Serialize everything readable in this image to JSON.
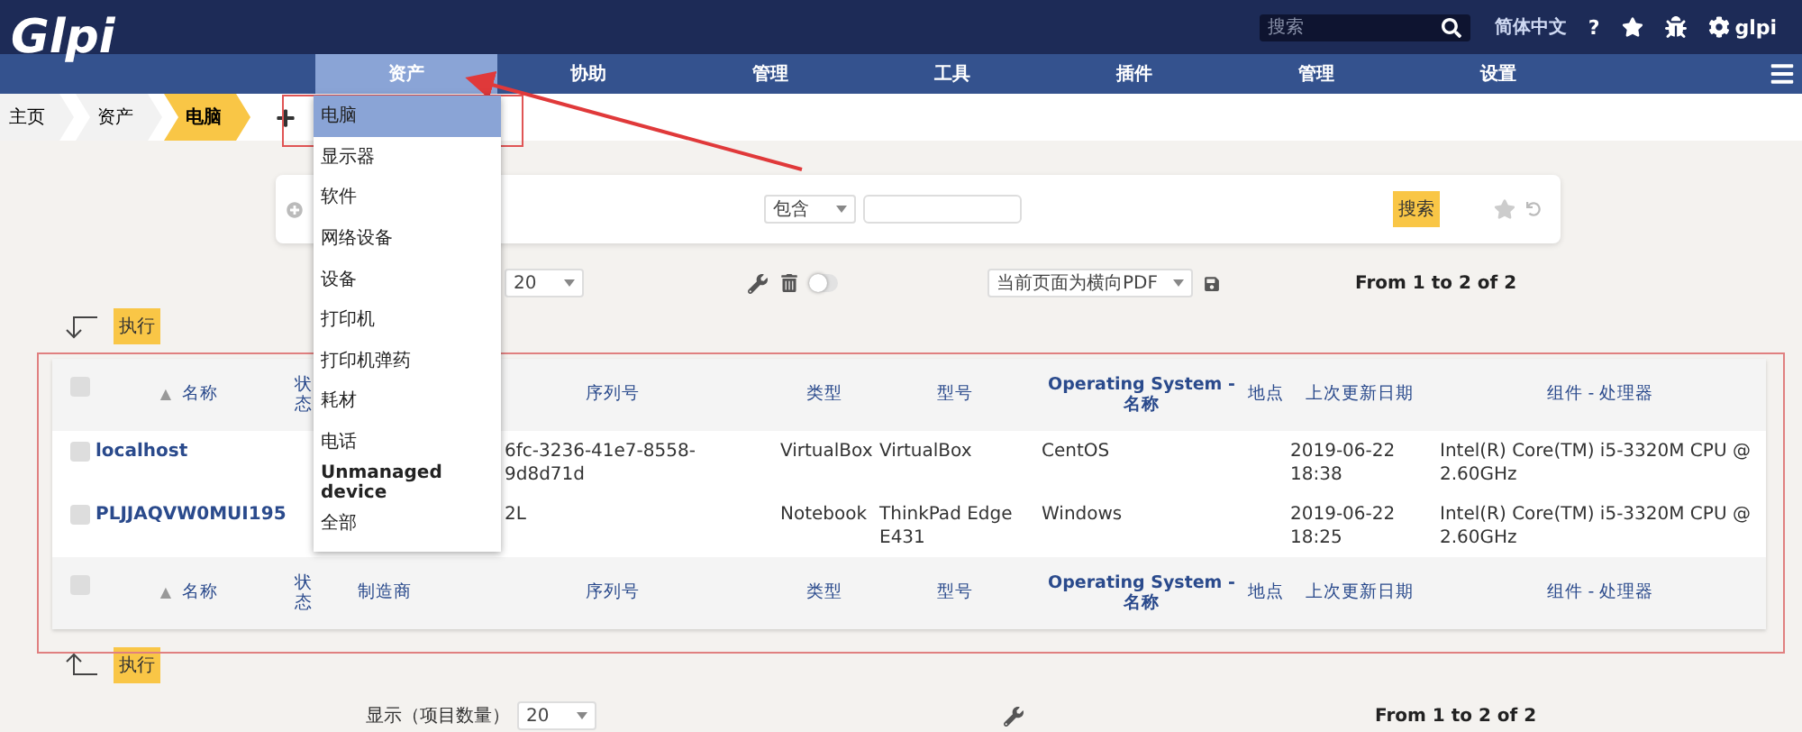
{
  "header": {
    "logo": "Glpi",
    "search_placeholder": "搜索",
    "language": "简体中文",
    "help": "?",
    "user": "glpi"
  },
  "nav": [
    {
      "label": "资产",
      "selected": true
    },
    {
      "label": "协助",
      "selected": false
    },
    {
      "label": "管理",
      "selected": false
    },
    {
      "label": "工具",
      "selected": false
    },
    {
      "label": "插件",
      "selected": false
    },
    {
      "label": "管理",
      "selected": false
    },
    {
      "label": "设置",
      "selected": false
    }
  ],
  "breadcrumb": [
    {
      "label": "主页",
      "selected": false
    },
    {
      "label": "资产",
      "selected": false
    },
    {
      "label": "电脑",
      "selected": true
    }
  ],
  "assets_menu": [
    {
      "label": "电脑",
      "selected": true,
      "bold": false
    },
    {
      "label": "显示器",
      "selected": false,
      "bold": false
    },
    {
      "label": "软件",
      "selected": false,
      "bold": false
    },
    {
      "label": "网络设备",
      "selected": false,
      "bold": false
    },
    {
      "label": "设备",
      "selected": false,
      "bold": false
    },
    {
      "label": "打印机",
      "selected": false,
      "bold": false
    },
    {
      "label": "打印机弹药",
      "selected": false,
      "bold": false
    },
    {
      "label": "耗材",
      "selected": false,
      "bold": false
    },
    {
      "label": "电话",
      "selected": false,
      "bold": false
    },
    {
      "label": "Unmanaged device",
      "selected": false,
      "bold": true
    },
    {
      "label": "全部",
      "selected": false,
      "bold": false
    }
  ],
  "search_panel": {
    "operator": "包含",
    "button": "搜索"
  },
  "list_controls": {
    "per_page": "20",
    "toggle_on": false,
    "export": "当前页面为横向PDF",
    "pagination": "From 1 to 2 of 2",
    "action": "执行"
  },
  "table": {
    "select_all": [
      {
        "checked": false
      },
      {
        "checked": false
      }
    ],
    "header_top": [
      {
        "kind": "label",
        "label": "名称",
        "sort_mark": "▲"
      },
      {
        "kind": "label",
        "label": "状态"
      },
      {
        "kind": "covered"
      },
      {
        "kind": "label",
        "label": "序列号"
      },
      {
        "kind": "label",
        "label": "类型"
      },
      {
        "kind": "label",
        "label": "型号"
      },
      {
        "kind": "label",
        "label": "Operating System - 名称"
      },
      {
        "kind": "label",
        "label": "地点"
      },
      {
        "kind": "label",
        "label": "上次更新日期"
      },
      {
        "kind": "label",
        "label": "组件 - 处理器"
      }
    ],
    "rows": [
      {
        "checked": false,
        "cells": [
          "localhost",
          null,
          null,
          "6fc-3236-41e7-8558-9d8d71d",
          "VirtualBox",
          "VirtualBox",
          "CentOS",
          null,
          "2019-06-22 18:38",
          "Intel(R) Core(TM) i5-3320M CPU @ 2.60GHz"
        ]
      },
      {
        "checked": false,
        "cells": [
          "PLJJAQVW0MUI195",
          null,
          null,
          "2L",
          "Notebook",
          "ThinkPad Edge E431",
          "Windows",
          null,
          "2019-06-22 18:25",
          "Intel(R) Core(TM) i5-3320M CPU @ 2.60GHz"
        ]
      }
    ],
    "header_bottom": [
      {
        "kind": "label",
        "label": "名称",
        "sort_mark": "▲"
      },
      {
        "kind": "label",
        "label": "状态"
      },
      {
        "kind": "label",
        "label": "制造商"
      },
      {
        "kind": "label",
        "label": "序列号"
      },
      {
        "kind": "label",
        "label": "类型"
      },
      {
        "kind": "label",
        "label": "型号"
      },
      {
        "kind": "label",
        "label": "Operating System - 名称"
      },
      {
        "kind": "label",
        "label": "地点"
      },
      {
        "kind": "label",
        "label": "上次更新日期"
      },
      {
        "kind": "label",
        "label": "组件 - 处理器"
      }
    ]
  },
  "bottom_controls": {
    "action": "执行",
    "per_page_label": "显示（项目数量）",
    "per_page": "20",
    "pagination": "From 1 to 2 of 2"
  }
}
